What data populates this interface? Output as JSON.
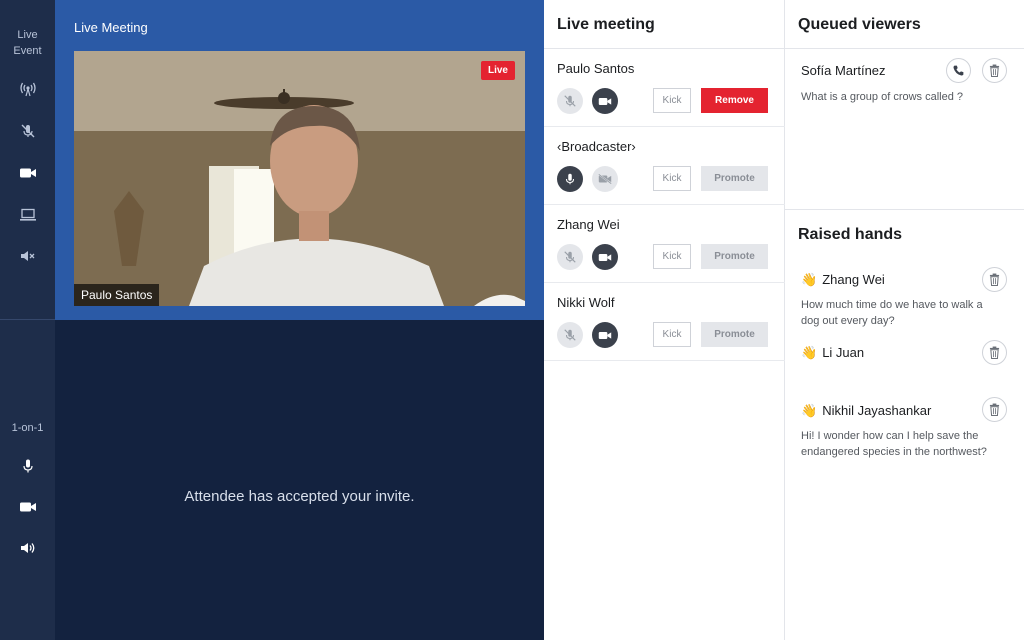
{
  "rail": {
    "live_event_label": "Live\nEvent",
    "one_on_one_label": "1-on-1",
    "icons": [
      "broadcast-icon",
      "mic-muted-icon",
      "camera-icon",
      "screen-share-icon",
      "speaker-muted-icon",
      "mic-icon",
      "camera-icon",
      "speaker-icon"
    ]
  },
  "stage": {
    "title": "Live Meeting",
    "live_badge": "Live",
    "speaker_name": "Paulo Santos",
    "bottom_message": "Attendee has accepted your invite."
  },
  "live_meeting": {
    "title": "Live meeting",
    "participants": [
      {
        "name": "Paulo Santos",
        "mic": "muted-light",
        "camera": "on-dark",
        "kick_label": "Kick",
        "action_label": "Remove",
        "action": "remove"
      },
      {
        "name": "‹Broadcaster›",
        "mic": "on-dark",
        "camera": "off-light",
        "kick_label": "Kick",
        "action_label": "Promote",
        "action": "promote"
      },
      {
        "name": "Zhang Wei",
        "mic": "muted-light",
        "camera": "on-dark",
        "kick_label": "Kick",
        "action_label": "Promote",
        "action": "promote"
      },
      {
        "name": "Nikki Wolf",
        "mic": "muted-light",
        "camera": "on-dark",
        "kick_label": "Kick",
        "action_label": "Promote",
        "action": "promote"
      }
    ]
  },
  "queued_viewers": {
    "title": "Queued viewers",
    "items": [
      {
        "name": "Sofía Martínez",
        "question": "What is a group of crows called ?"
      }
    ]
  },
  "raised_hands": {
    "title": "Raised hands",
    "hand_icon": "👋",
    "items": [
      {
        "name": "Zhang Wei",
        "question": "How much time do we have to walk a dog out every day?"
      },
      {
        "name": "Li Juan",
        "question": ""
      },
      {
        "name": "Nikhil Jayashankar",
        "question": "Hi! I wonder how can I help save the endangered species in the northwest?"
      }
    ]
  },
  "colors": {
    "rail": "#1e2d4a",
    "stage_top": "#2b5aa6",
    "stage_bottom": "#13223f",
    "live_red": "#e42330"
  }
}
